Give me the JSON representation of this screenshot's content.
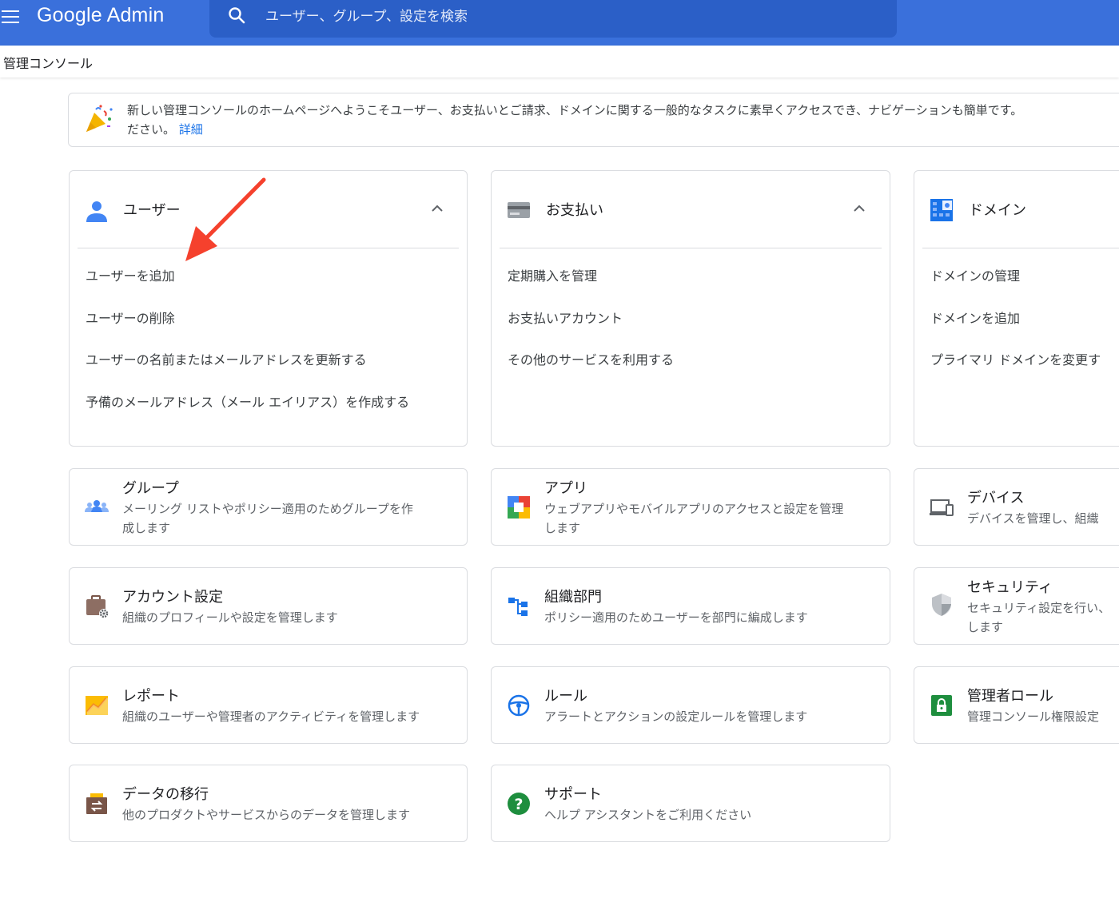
{
  "header": {
    "logo_text": "Google Admin",
    "search_placeholder": "ユーザー、グループ、設定を検索"
  },
  "breadcrumb": "管理コンソール",
  "banner": {
    "line1": "新しい管理コンソールのホームページへようこそユーザー、お支払いとご請求、ドメインに関する一般的なタスクに素早くアクセスでき、ナビゲーションも簡単です。",
    "line2": "ださい。",
    "link": "詳細"
  },
  "users_card": {
    "title": "ユーザー",
    "links": [
      "ユーザーを追加",
      "ユーザーの削除",
      "ユーザーの名前またはメールアドレスを更新する",
      "予備のメールアドレス（メール エイリアス）を作成する"
    ]
  },
  "billing_card": {
    "title": "お支払い",
    "links": [
      "定期購入を管理",
      "お支払いアカウント",
      "その他のサービスを利用する"
    ]
  },
  "domain_card": {
    "title": "ドメイン",
    "links": [
      "ドメインの管理",
      "ドメインを追加",
      "プライマリ ドメインを変更す"
    ]
  },
  "tiles": [
    {
      "title": "グループ",
      "desc1": "メーリング リストやポリシー適用のためグループを作",
      "desc2": "成します",
      "icon": "groups-icon"
    },
    {
      "title": "アプリ",
      "desc1": "ウェブアプリやモバイルアプリのアクセスと設定を管理",
      "desc2": "します",
      "icon": "apps-icon"
    },
    {
      "title": "デバイス",
      "desc1": "デバイスを管理し、組織",
      "desc2": "",
      "icon": "devices-icon"
    },
    {
      "title": "アカウント設定",
      "desc1": "組織のプロフィールや設定を管理します",
      "desc2": "",
      "icon": "account-settings-icon"
    },
    {
      "title": "組織部門",
      "desc1": "ポリシー適用のためユーザーを部門に編成します",
      "desc2": "",
      "icon": "org-units-icon"
    },
    {
      "title": "セキュリティ",
      "desc1": "セキュリティ設定を行い、",
      "desc2": "します",
      "icon": "security-shield-icon"
    },
    {
      "title": "レポート",
      "desc1": "組織のユーザーや管理者のアクティビティを管理します",
      "desc2": "",
      "icon": "reports-chart-icon"
    },
    {
      "title": "ルール",
      "desc1": "アラートとアクションの設定ルールを管理します",
      "desc2": "",
      "icon": "rules-icon"
    },
    {
      "title": "管理者ロール",
      "desc1": "管理コンソール権限設定",
      "desc2": "",
      "icon": "admin-roles-lock-icon"
    },
    {
      "title": "データの移行",
      "desc1": "他のプロダクトやサービスからのデータを管理します",
      "desc2": "",
      "icon": "data-migration-icon"
    },
    {
      "title": "サポート",
      "desc1": "ヘルプ アシスタントをご利用ください",
      "desc2": "",
      "icon": "support-help-icon"
    }
  ],
  "colors": {
    "header_blue": "#3a70db",
    "search_blue": "#2b5fc7",
    "link_blue": "#1a73e8",
    "annotation_red": "#f5412d"
  }
}
